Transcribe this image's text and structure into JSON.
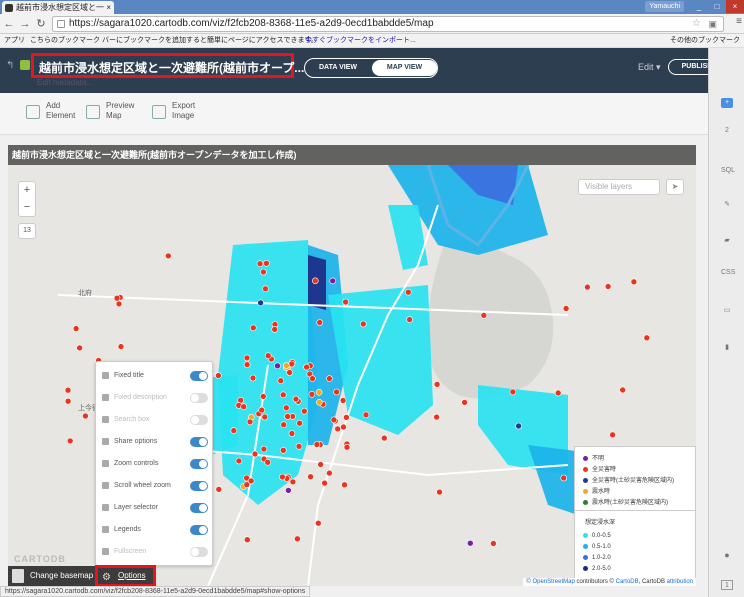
{
  "browser": {
    "tab_title": "越前市浸水想定区域と一",
    "window_user": "Yamauchi",
    "url": "https://sagara1020.cartodb.com/viz/f2fcb208-8368-11e5-a2d9-0ecd1babdde5/map",
    "bookmarks": {
      "apps": "アプリ",
      "message": "こちらのブックマーク バーにブックマークを追加すると簡単にページにアクセスできます。",
      "import_link": "今すぐブックマークをインポート...",
      "other": "その他のブックマーク"
    },
    "status_url": "https://sagara1020.cartodb.com/viz/f2fcb208-8368-11e5-a2d9-0ecd1babdde5/map#show-options"
  },
  "header": {
    "viz_title": "越前市浸水想定区域と一次避難所(越前市オープ...",
    "description": "Edit metadata...",
    "tabs": {
      "data_view": "DATA VIEW",
      "map_view": "MAP VIEW"
    },
    "edit": "Edit ▾",
    "publish": "PUBLISH"
  },
  "actions": [
    {
      "l1": "Add",
      "l2": "Element"
    },
    {
      "l1": "Preview",
      "l2": "Map"
    },
    {
      "l1": "Export",
      "l2": "Image"
    }
  ],
  "map": {
    "title": "越前市浸水想定区域と一次避難所(越前市オープンデータを加工し作成)",
    "zoom_in": "+",
    "zoom_out": "−",
    "zoom_level": "13",
    "visible_layers": "Visible layers",
    "logo": "CARTODB",
    "attribution": {
      "osm": "© OpenStreetMap",
      "rest1": " contributors © ",
      "cartodb": "CartoDB",
      "rest2": ", CartoDB ",
      "attr": "attribution"
    },
    "colors": {
      "shelter": "#e8361e",
      "flood_1": "#29e3f0",
      "flood_2": "#1bb3ea",
      "flood_3": "#3c6ee0",
      "flood_4": "#1c2a86"
    }
  },
  "legend": {
    "points": [
      {
        "label": "不明",
        "color": "#7b1fa2"
      },
      {
        "label": "全災害時",
        "color": "#e8361e"
      },
      {
        "label": "全災害時(土砂災害危険区域内)",
        "color": "#1f3b8a"
      },
      {
        "label": "震水時",
        "color": "#f5a623"
      },
      {
        "label": "震水時(土砂災害危険区域内)",
        "color": "#2e7d32"
      }
    ],
    "title": "想定浸水深",
    "depths": [
      {
        "label": "0.0-0.5",
        "color": "#29e3f0"
      },
      {
        "label": "0.5-1.0",
        "color": "#1bb3ea"
      },
      {
        "label": "1.0-2.0",
        "color": "#3c6ee0"
      },
      {
        "label": "2.0-5.0",
        "color": "#1c2a86"
      }
    ]
  },
  "options": [
    {
      "label": "Fixed title",
      "on": true,
      "disabled": false,
      "icon": "title-icon"
    },
    {
      "label": "Fixed description",
      "on": false,
      "disabled": true,
      "icon": "description-icon"
    },
    {
      "label": "Search box",
      "on": false,
      "disabled": true,
      "icon": "search-icon"
    },
    {
      "label": "Share options",
      "on": true,
      "disabled": false,
      "icon": "share-icon"
    },
    {
      "label": "Zoom controls",
      "on": true,
      "disabled": false,
      "icon": "zoom-icon"
    },
    {
      "label": "Scroll wheel zoom",
      "on": true,
      "disabled": false,
      "icon": "scroll-icon"
    },
    {
      "label": "Layer selector",
      "on": true,
      "disabled": false,
      "icon": "layers-icon"
    },
    {
      "label": "Legends",
      "on": true,
      "disabled": false,
      "icon": "legend-icon"
    },
    {
      "label": "Fullscreen",
      "on": false,
      "disabled": true,
      "icon": "fullscreen-icon"
    }
  ],
  "bottom": {
    "change_basemap": "Change basemap",
    "options": "Options"
  },
  "sidebar": [
    "+",
    "2",
    "SQL",
    "✎",
    "▰",
    "CSS",
    "▭",
    "▮"
  ]
}
